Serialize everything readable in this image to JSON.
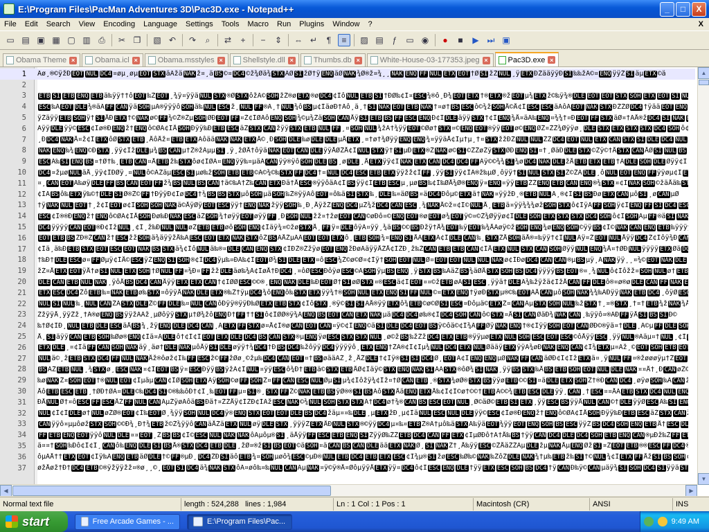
{
  "window": {
    "title": "E:\\Program Files\\PacMan Adventures 3D\\Pac3D.exe - Notepad++",
    "minimize": "_",
    "maximize": "□",
    "close": "X"
  },
  "menu": [
    "File",
    "Edit",
    "Search",
    "View",
    "Encoding",
    "Language",
    "Settings",
    "Tools",
    "Macro",
    "Run",
    "Plugins",
    "Window",
    "?"
  ],
  "menu_close": "X",
  "toolbar_icons": [
    "new-icon",
    "open-icon",
    "save-icon",
    "save-all-icon",
    "close-icon",
    "close-all-icon",
    "print-icon",
    "cut-icon",
    "copy-icon",
    "paste-icon",
    "undo-icon",
    "redo-icon",
    "find-icon",
    "replace-icon",
    "zoom-in-icon",
    "zoom-out-icon",
    "sync-v-icon",
    "sync-h-icon",
    "word-wrap-icon",
    "all-chars-icon",
    "indent-guide-icon",
    "user-lang-icon",
    "doc-map-icon",
    "function-list-icon",
    "folder-icon",
    "monitor-icon",
    "record-icon",
    "stop-icon",
    "play-icon",
    "play-multi-icon",
    "save-macro-icon"
  ],
  "tabs": [
    {
      "label": "Obama Theme",
      "active": false
    },
    {
      "label": "Obama.icl",
      "active": false
    },
    {
      "label": "Obama.msstyles",
      "active": false
    },
    {
      "label": "Shellstyle.dll",
      "active": false
    },
    {
      "label": "Thumbs.db",
      "active": false
    },
    {
      "label": "White-House-03-177353.jpeg",
      "active": false
    },
    {
      "label": "Pac3D.exe",
      "active": true
    }
  ],
  "editor": {
    "lines": [
      {
        "n": "1"
      },
      {
        "n": "2"
      },
      {
        "n": "3"
      },
      {
        "n": "4"
      },
      {
        "n": "5"
      },
      {
        "n": "6"
      },
      {
        "n": "7"
      },
      {
        "n": "8"
      },
      {
        "n": "9"
      },
      {
        "n": "10"
      },
      {
        "n": "11"
      },
      {
        "n": "12"
      },
      {
        "n": "13"
      },
      {
        "n": "14"
      },
      {
        "n": "15"
      },
      {
        "n": "16"
      },
      {
        "n": "17"
      },
      {
        "n": "18"
      },
      {
        "n": "19"
      },
      {
        "n": "20"
      },
      {
        "n": "21"
      },
      {
        "n": "22"
      },
      {
        "n": "23"
      },
      {
        "n": "24"
      },
      {
        "n": "25"
      },
      {
        "n": "26"
      },
      {
        "n": "27"
      },
      {
        "n": "28"
      },
      {
        "n": "29"
      },
      {
        "n": "30"
      },
      {
        "n": "31"
      },
      {
        "n": "32"
      },
      {
        "n": "33"
      },
      {
        "n": "34"
      },
      {
        "n": "35"
      },
      {
        "n": "36"
      },
      {
        "n": "37"
      }
    ]
  },
  "status": {
    "file_type": "Normal text file",
    "length": "length : 524,288",
    "lines": "lines : 1,984",
    "position": "Ln : 1    Col : 1    Pos : 1",
    "eol": "Macintosh (CR)",
    "encoding": "ANSI",
    "mode": "INS"
  },
  "taskbar": {
    "start": "start",
    "tasks": [
      {
        "label": "Free Arcade Games - ...",
        "active": false
      },
      {
        "label": "E:\\Program Files\\Pac...",
        "active": true
      }
    ],
    "clock": "9:49 AM"
  }
}
